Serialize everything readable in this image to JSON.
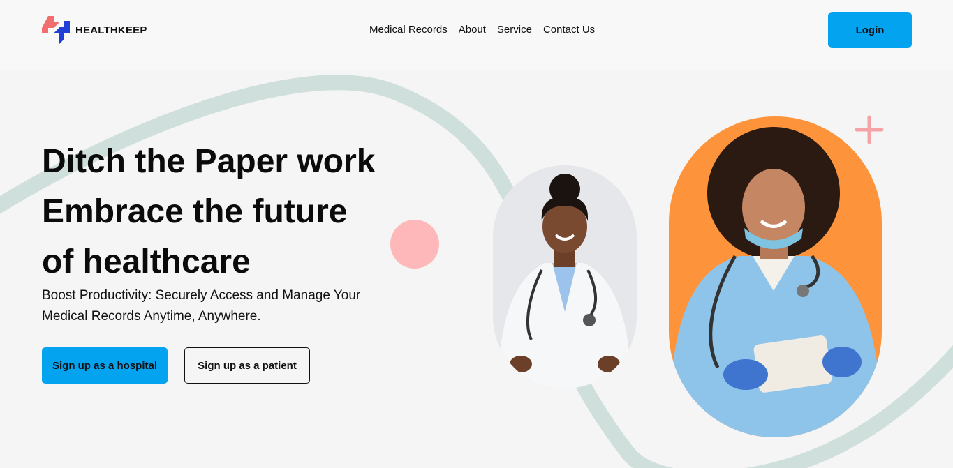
{
  "header": {
    "brand": "HEALTHKEEP",
    "nav": [
      "Medical Records",
      "About",
      "Service",
      "Contact Us"
    ],
    "login_label": "Login"
  },
  "hero": {
    "title_lines": [
      "Ditch the Paper work",
      "Embrace the future",
      "of healthcare"
    ],
    "subtitle": "Boost Productivity: Securely Access and Manage Your Medical Records Anytime, Anywhere.",
    "hospital_button": "Sign up as a hospital",
    "patient_button": "Sign up as a patient"
  },
  "colors": {
    "accent": "#04a3f0",
    "logo_red": "#f26d6d",
    "logo_blue": "#1f3fd6",
    "orange": "#fd943b",
    "pink": "#ffb8ba",
    "swoosh": "#cfe0dc"
  },
  "icons": {
    "logo": "medical-cross-logo-icon",
    "decoration": "plus-icon"
  }
}
